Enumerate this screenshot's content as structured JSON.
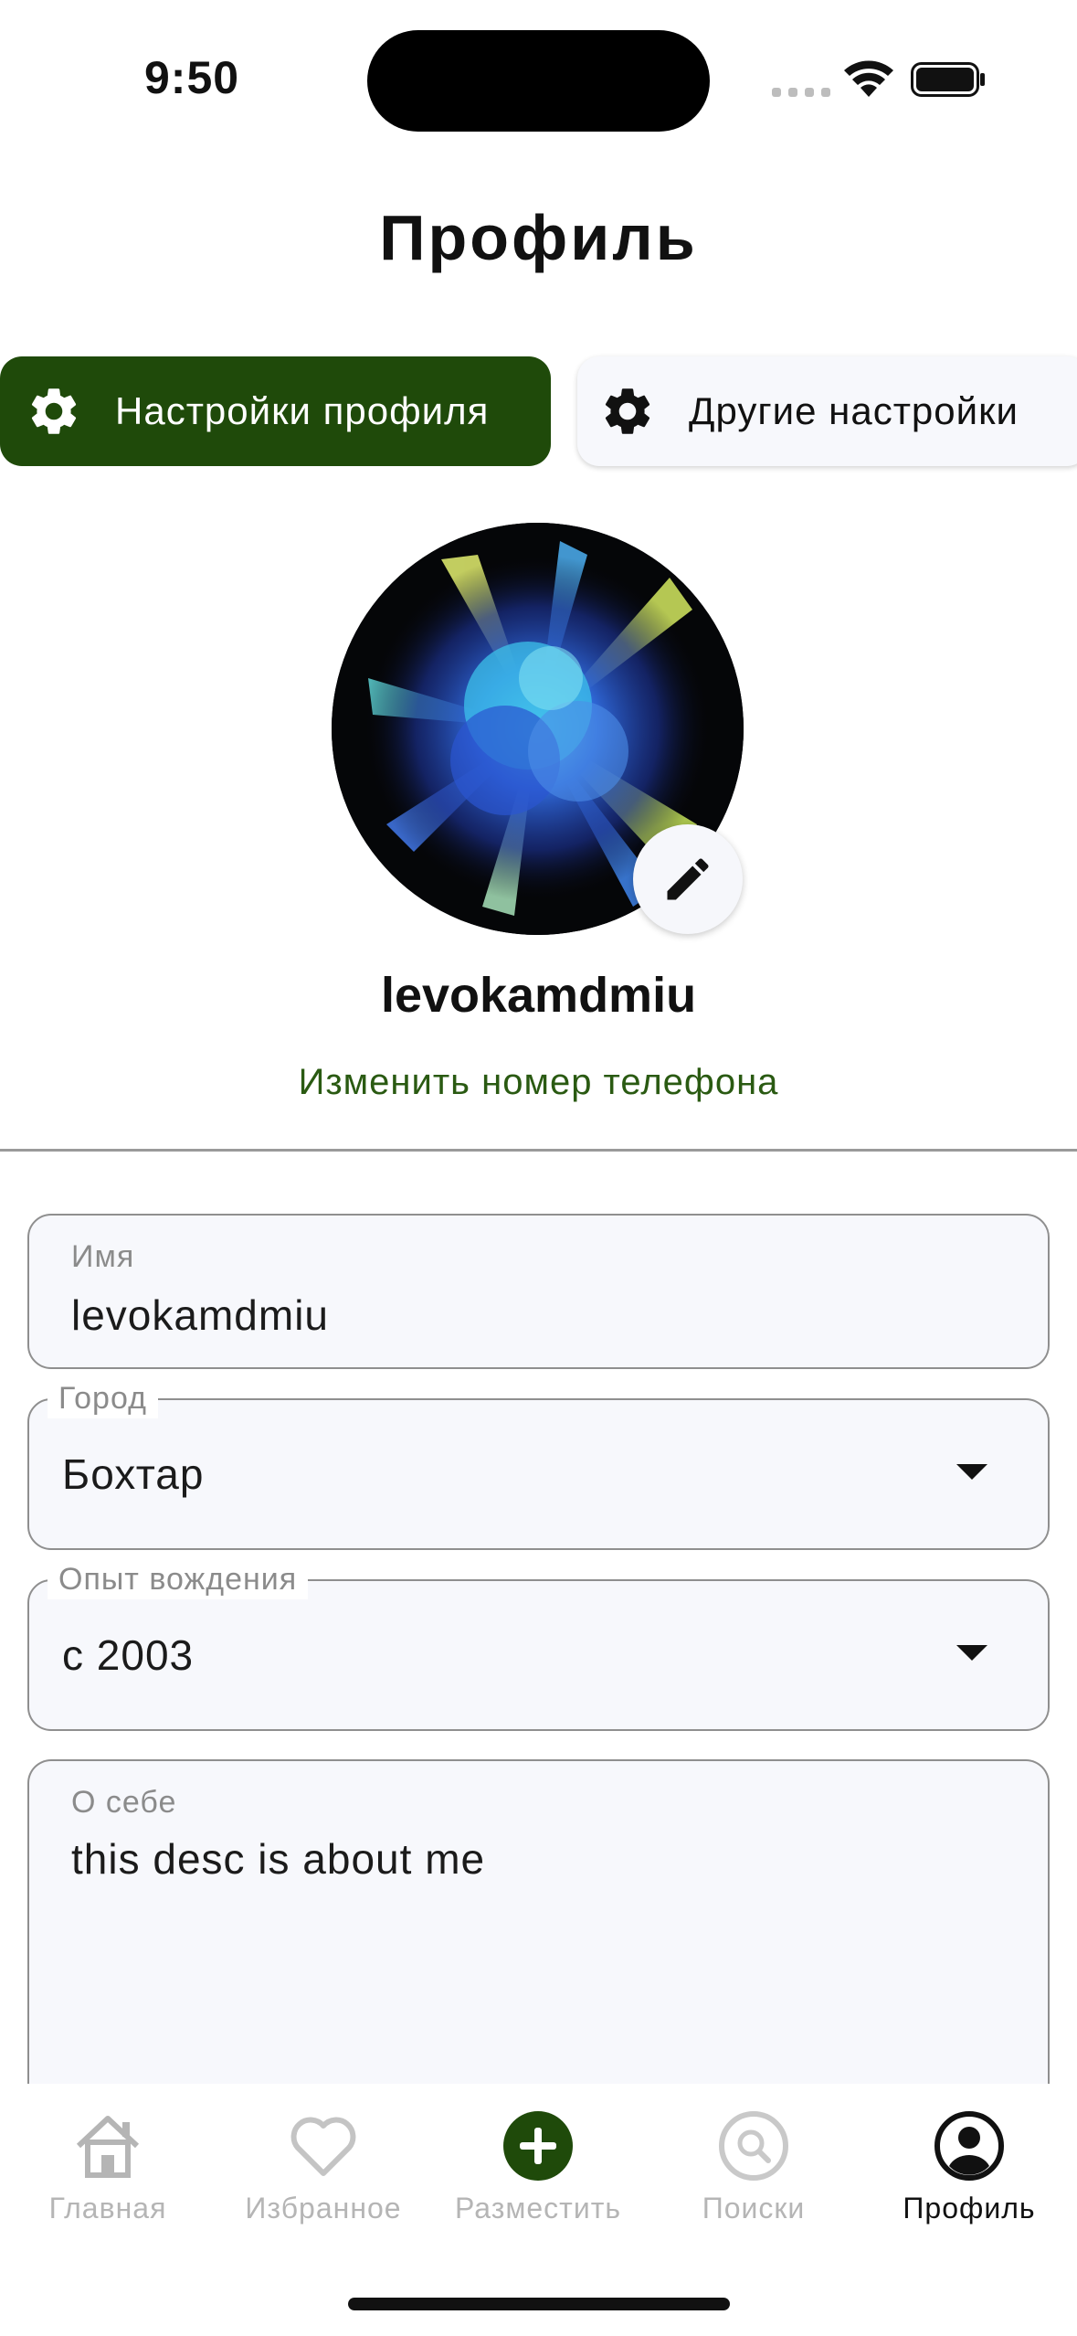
{
  "status_bar": {
    "time": "9:50"
  },
  "header": {
    "title": "Профиль"
  },
  "tabs": [
    {
      "label": "Настройки профиля",
      "icon": "gear-icon",
      "active": true
    },
    {
      "label": "Другие настройки",
      "icon": "gear-icon",
      "active": false
    }
  ],
  "profile": {
    "username": "levokamdmiu",
    "change_phone_link": "Изменить номер телефона"
  },
  "form": {
    "name": {
      "label": "Имя",
      "value": "levokamdmiu"
    },
    "city": {
      "label": "Город",
      "value": "Бохтар"
    },
    "experience": {
      "label": "Опыт вождения",
      "value": "с 2003"
    },
    "about": {
      "label": "О себе",
      "value": "this desc is about me"
    }
  },
  "bottom_nav": [
    {
      "label": "Главная",
      "icon": "home-icon",
      "active": false
    },
    {
      "label": "Избранное",
      "icon": "heart-icon",
      "active": false
    },
    {
      "label": "Разместить",
      "icon": "add-circle-icon",
      "active": false
    },
    {
      "label": "Поиски",
      "icon": "search-icon",
      "active": false
    },
    {
      "label": "Профиль",
      "icon": "account-icon",
      "active": true
    }
  ],
  "colors": {
    "brand_green": "#1f4a0a",
    "link_green": "#2a5a12",
    "field_bg": "#f7f8fc",
    "inactive_nav": "#b5b5b5"
  }
}
